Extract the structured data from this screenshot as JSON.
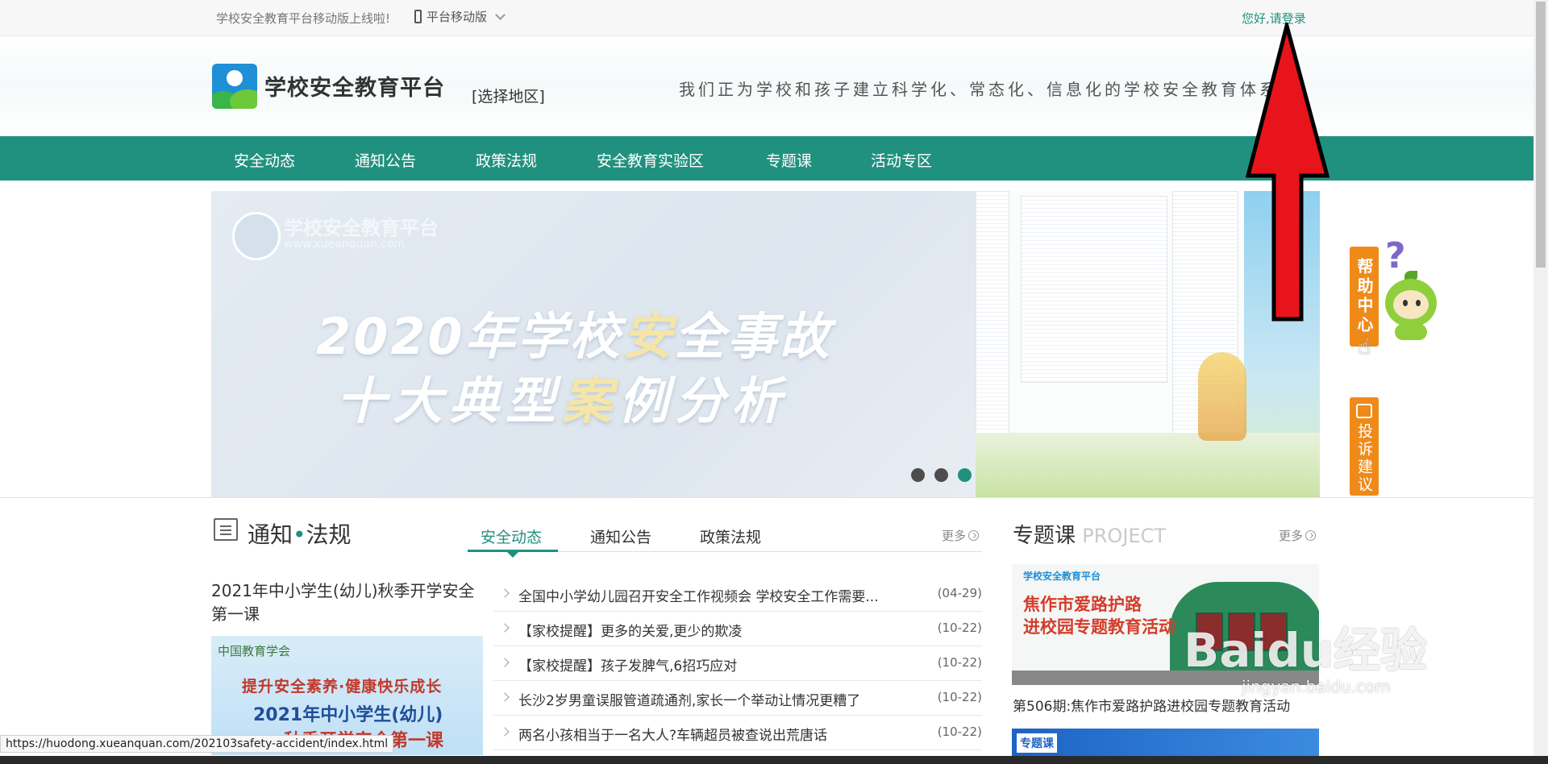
{
  "topbar": {
    "notice": "学校安全教育平台移动版上线啦!",
    "mobile_label": "平台移动版",
    "greeting": "您好,",
    "login_link": "请登录"
  },
  "header": {
    "logo_text": "学校安全教育平台",
    "region_label": "[选择地区]",
    "slogan": "我们正为学校和孩子建立科学化、常态化、信息化的学校安全教育体系"
  },
  "nav": {
    "items": [
      "安全动态",
      "通知公告",
      "政策法规",
      "安全教育实验区",
      "专题课",
      "活动专区"
    ]
  },
  "banner": {
    "brand_name": "学校安全教育平台",
    "brand_url": "www.xueanquan.com",
    "line1_a": "2020年学校",
    "line1_b": "安",
    "line1_c": "全事故",
    "line2_a": "十大典型",
    "line2_b": "案",
    "line2_c": "例分析",
    "slide_count": 3,
    "active_slide": 3
  },
  "side": {
    "help_label": "帮助中心",
    "help_qmark": "?",
    "complaint_label": "投诉建议"
  },
  "notice_section": {
    "title_a": "通知",
    "title_sep": "•",
    "title_b": "法规",
    "tabs": [
      "安全动态",
      "通知公告",
      "政策法规"
    ],
    "active_tab": "安全动态",
    "more_label": "更多",
    "featured_title": "2021年中小学生(幼儿)秋季开学安全第一课",
    "featured_image": {
      "org": "中国教育学会",
      "line1": "提升安全素养·健康快乐成长",
      "line2": "2021年中小学生(幼儿)",
      "line3": "秋季开学安全第一课"
    },
    "news": [
      {
        "title": "全国中小学幼儿园召开安全工作视频会 学校安全工作需要...",
        "date": "(04-29)"
      },
      {
        "title": "【家校提醒】更多的关爱,更少的欺凌",
        "date": "(10-22)"
      },
      {
        "title": "【家校提醒】孩子发脾气,6招巧应对",
        "date": "(10-22)"
      },
      {
        "title": "长沙2岁男童误服管道疏通剂,家长一个举动让情况更糟了",
        "date": "(10-22)"
      },
      {
        "title": "两名小孩相当于一名大人?车辆超员被查说出荒唐话",
        "date": "(10-22)"
      }
    ]
  },
  "project_section": {
    "title": "专题课",
    "title_en": "PROJECT",
    "more_label": "更多",
    "image1": {
      "logo": "学校安全教育平台",
      "line1": "焦作市爱路护路",
      "line2": "进校园专题教育活动"
    },
    "caption": "第506期:焦作市爱路护路进校园专题教育活动",
    "image2_tag": "专题课"
  },
  "status_url": "https://huodong.xueanquan.com/202103safety-accident/index.html",
  "watermark": {
    "main": "Baidu经验",
    "sub": "jingyan.baidu.com"
  },
  "colors": {
    "brand_green": "#21917f",
    "side_orange": "#ef8a19",
    "annotation_red": "#e8141b"
  }
}
